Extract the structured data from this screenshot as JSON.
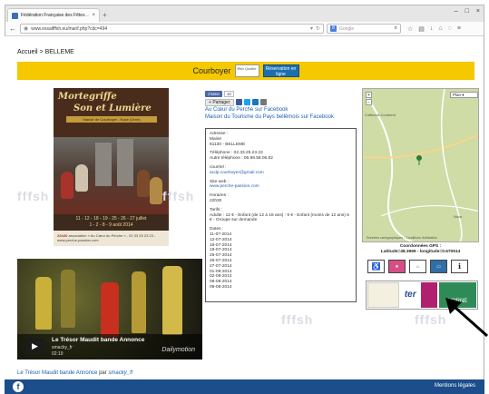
{
  "browser": {
    "tab_title": "Fédération Française des Fêtes ...",
    "tab_close": "×",
    "new_tab": "+",
    "url": "www.essaifffsh.eu/marif.php?cdc=494",
    "search_placeholder": "Google",
    "window_buttons": [
      "–",
      "□",
      "×"
    ]
  },
  "breadcrumb": {
    "home": "Accueil",
    "separator": " > ",
    "current": "BELLEME"
  },
  "header": {
    "city": "Courboyer",
    "quality_label": "fffsh Qualité",
    "booking_label": "Réservation en ligne"
  },
  "poster": {
    "title_line1": "Mortegriffe",
    "title_line2": "Son et Lumière",
    "subtitle": "Manoir de Courboyer - Noce (Orne)",
    "dates_line1": "11 - 12 - 18 - 19 - 25 - 26 - 27 juillet",
    "dates_line2": "1 - 2 - 8 - 9 août 2014",
    "time": "22h30",
    "footer": "association « Au Cœur du Perche » - 02 33 25 23 23 - www.perche-passion.com"
  },
  "social": {
    "like_label": "J'aime",
    "like_count": "12",
    "share_label": "Partager",
    "facebook_link1": "Au Cœur du Perche sur Facebook",
    "facebook_link2": "Maison du Tourisme du Pays bellêmois sur Facebook"
  },
  "info": {
    "address_label": "Adresse :",
    "address_line1": "Mairie",
    "address_line2": "61130 - BELLEME",
    "phone_label": "Téléphone : 02.33.25.23.23",
    "phone_alt": "Autre téléphone : 06.98.58.06.82",
    "email_label": "courriel :",
    "email": "acdp.courboyer@gmail.com",
    "web_label": "Site web :",
    "web": "www.perche-passion.com",
    "hours_label": "Horaires :",
    "hours": "22h30",
    "rates_label": "Tarifs :",
    "rates": "Adulte : 12 € - Enfant (de 12 à 18 ans) : 9 € - Enfant (moins de 12 ans) 5 € - Groupe sur demande",
    "dates_label": "Dates :",
    "dates": [
      "11-07-2014",
      "12-07-2014",
      "18-07-2014",
      "19-07-2014",
      "25-07-2014",
      "26-07-2014",
      "27-07-2014",
      "01-08-2014",
      "02-08-2014",
      "08-08-2014",
      "09-08-2014"
    ]
  },
  "map": {
    "type_label": "Plan",
    "zoom_in": "+",
    "zoom_out": "−",
    "place1": "Coffinard-Courbent",
    "place2": "Noce",
    "footer_text": "Données cartographiques · Conditions d'utilisation",
    "coords_title": "Coordonnées GPS :",
    "coords": "Latitude=48.3969 - longitude=0.670514"
  },
  "icons": [
    "wheelchair-icon",
    "partner-icon",
    "tourism-label-icon",
    "chambre-icon",
    "info-icon"
  ],
  "logos": [
    "perche-logo",
    "ter-logo",
    "orne-dept-logo",
    "orne-logo"
  ],
  "logo_text": {
    "orne": "L'ORNE"
  },
  "video": {
    "title": "Le Trésor Maudit bande Annonce",
    "by": "smacky_fr",
    "duration": "02:19",
    "brand": "Dailymotion",
    "play": "▶"
  },
  "caption": {
    "text": "Le Trésor Maudit bande Annonce",
    "par": "par",
    "author": "smacky_fr"
  },
  "watermark": "fffsh",
  "footer": {
    "legal": "Mentions légales",
    "fb": "f"
  },
  "colors": {
    "yellow": "#f5c800",
    "footer_blue": "#1b4e8a",
    "link_blue": "#1f5fae"
  }
}
